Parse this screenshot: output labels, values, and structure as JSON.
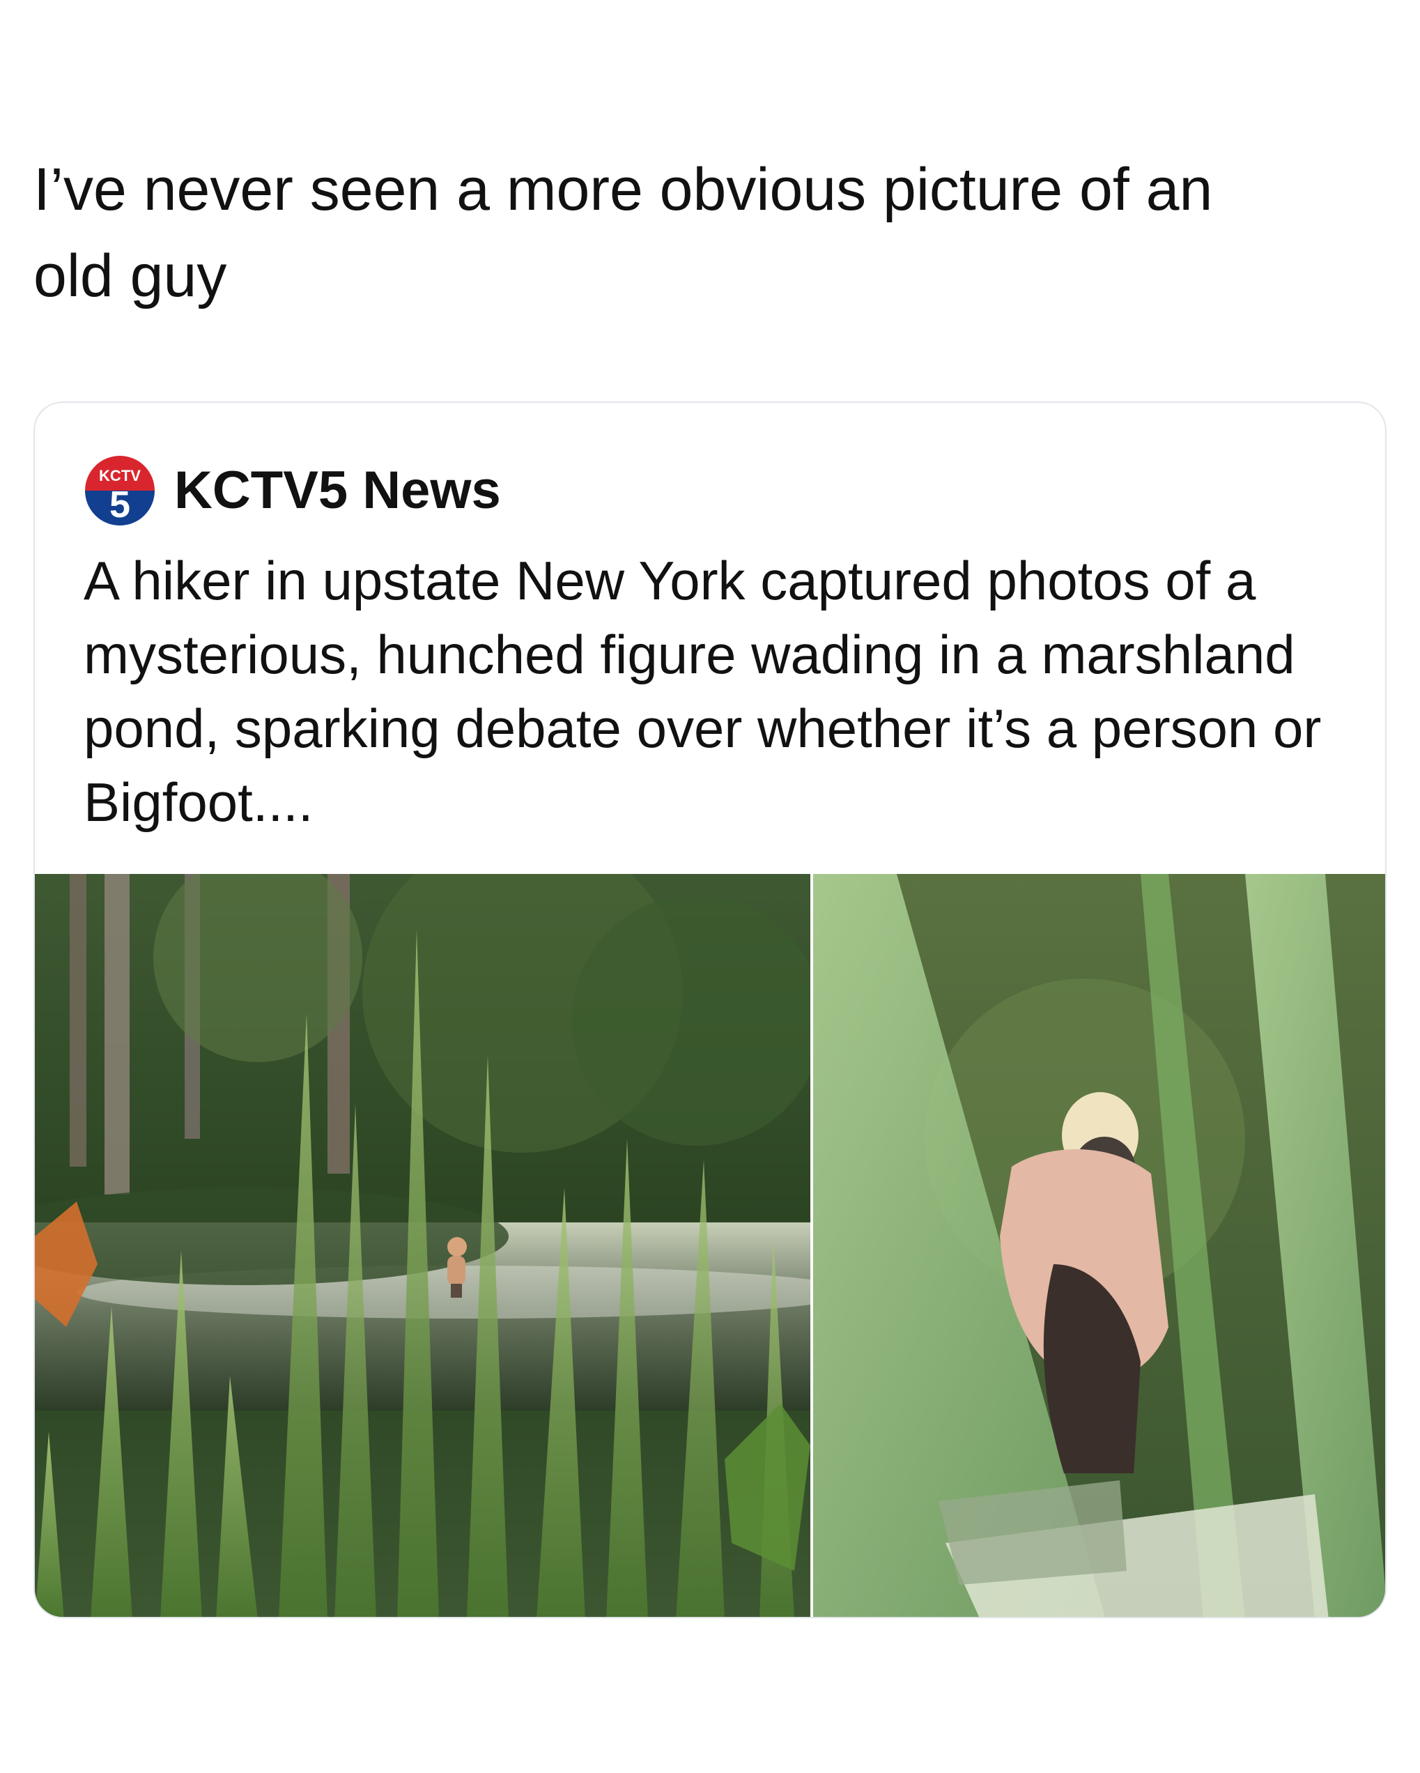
{
  "post": {
    "text": "I’ve never seen a more obvious picture of an\nold guy"
  },
  "quote": {
    "source_name": "KCTV5 News",
    "logo_top_text": "KCTV",
    "logo_number": "5",
    "text": "A hiker in upstate New York captured photos of a mysterious, hunched figure wading in a marshland pond, sparking debate over whether it’s a person or Bigfoot....",
    "brand_colors": {
      "red": "#d9262e",
      "blue": "#123f8f",
      "white": "#ffffff"
    }
  },
  "media": {
    "images": [
      {
        "name": "marsh-pond-photo",
        "description_icon": "photo-icon"
      },
      {
        "name": "zoomed-figure-photo",
        "description_icon": "photo-icon"
      }
    ]
  }
}
